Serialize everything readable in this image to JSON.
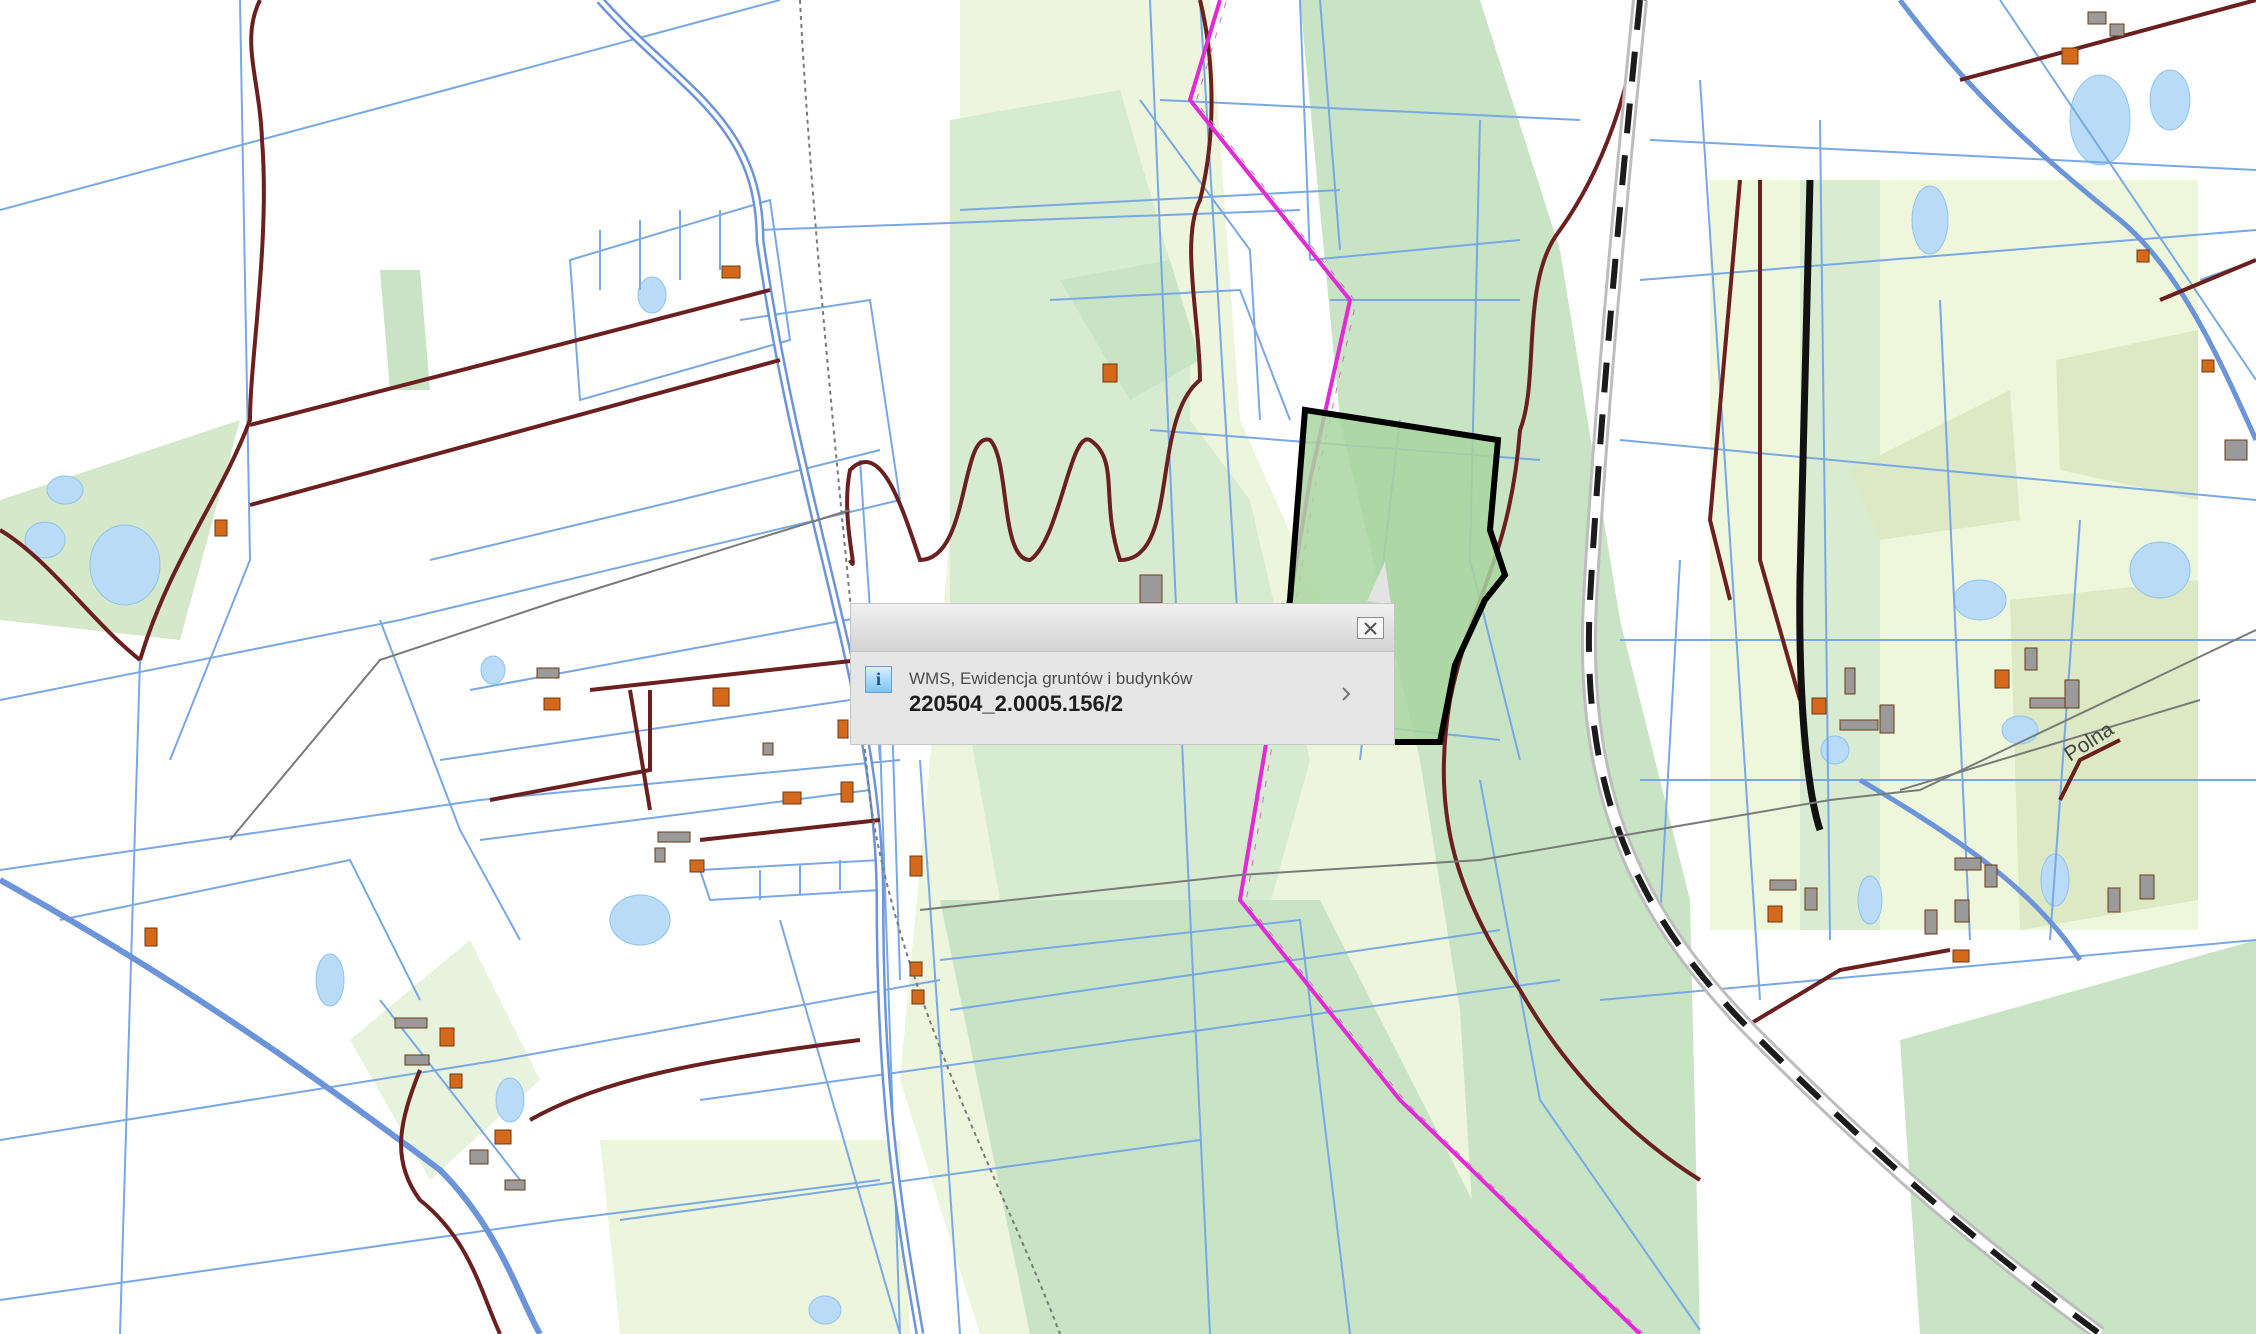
{
  "map": {
    "street_label": "Polna"
  },
  "popup": {
    "layer_name": "WMS, Ewidencja gruntów i budynków",
    "feature_id": "220504_2.0005.156/2",
    "icons": {
      "info": "info-icon",
      "close": "close-icon",
      "next": "chevron-right-icon"
    },
    "info_symbol": "i"
  },
  "colors": {
    "parcel_lines": "#78a8e5",
    "forest": "#c9e4c5",
    "meadow": "#edf5dc",
    "roads": "#6c1f1f",
    "boundary": "#e22bd6",
    "selected_parcel": "#000000",
    "buildings": "#d4681b",
    "water": "#b9dbf7"
  }
}
